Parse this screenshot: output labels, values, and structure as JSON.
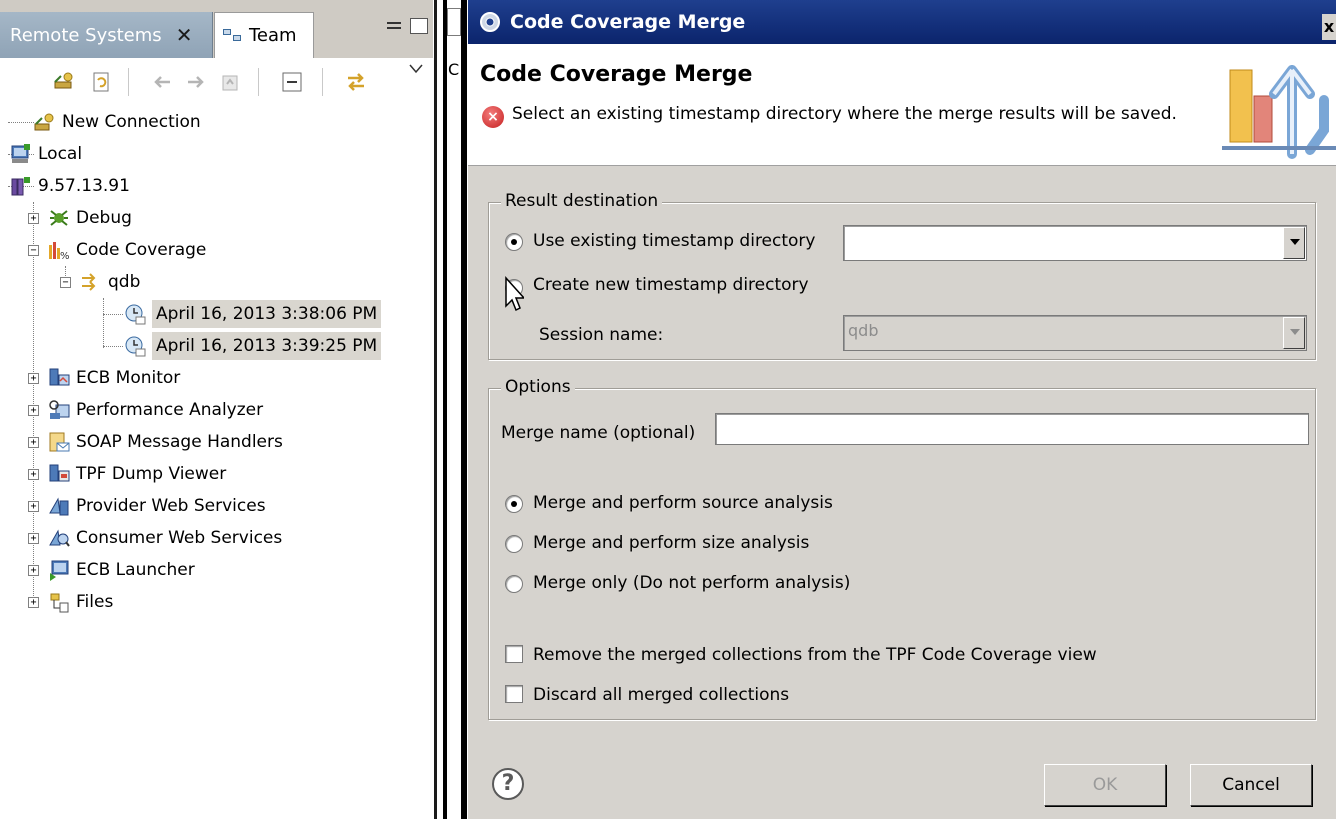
{
  "left_view": {
    "tabs": [
      {
        "label": "Remote Systems",
        "active": true
      },
      {
        "label": "Team",
        "active": false
      }
    ],
    "tree": {
      "items": [
        {
          "label": "New Connection"
        },
        {
          "label": "Local"
        },
        {
          "label": "9.57.13.91"
        },
        {
          "label": "Debug"
        },
        {
          "label": "Code Coverage"
        },
        {
          "label": "qdb"
        },
        {
          "label": "April 16, 2013 3:38:06 PM",
          "selected": true
        },
        {
          "label": "April 16, 2013 3:39:25 PM",
          "selected": true
        },
        {
          "label": "ECB Monitor"
        },
        {
          "label": "Performance Analyzer"
        },
        {
          "label": "SOAP Message Handlers"
        },
        {
          "label": "TPF Dump Viewer"
        },
        {
          "label": "Provider Web Services"
        },
        {
          "label": "Consumer Web Services"
        },
        {
          "label": "ECB Launcher"
        },
        {
          "label": "Files"
        }
      ]
    }
  },
  "editor_strip": {
    "partial_label": "C"
  },
  "dialog": {
    "window_title": "Code Coverage Merge",
    "close_glyph": "x",
    "header": {
      "title": "Code Coverage Merge",
      "error_message": "Select an existing timestamp directory where the merge results will be saved."
    },
    "result_destination": {
      "legend": "Result destination",
      "use_existing_label": "Use existing timestamp directory",
      "use_existing_selected": true,
      "timestamp_value": "",
      "create_new_label": "Create new timestamp directory",
      "create_new_selected": false,
      "session_name_label": "Session name:",
      "session_name_value": "qdb"
    },
    "options": {
      "legend": "Options",
      "merge_name_label": "Merge name (optional)",
      "merge_name_value": "",
      "radios": [
        {
          "label": "Merge and perform source analysis",
          "selected": true
        },
        {
          "label": "Merge and perform size analysis",
          "selected": false
        },
        {
          "label": "Merge only (Do not perform analysis)",
          "selected": false
        }
      ],
      "checkboxes": [
        {
          "label": "Remove the merged collections from the TPF Code Coverage view",
          "checked": false
        },
        {
          "label": "Discard all merged collections",
          "checked": false
        }
      ]
    },
    "buttons": {
      "ok": "OK",
      "cancel": "Cancel",
      "ok_enabled": false
    },
    "help_glyph": "?"
  },
  "colors": {
    "dialog_bg": "#d6d3ce",
    "titlebar": "#0b246c",
    "tab_active": "#8fa3b6",
    "selection": "#d9d6cf",
    "error": "#c51f1f"
  },
  "icons": [
    "new-connection-icon",
    "local-icon",
    "host-icon",
    "debug-icon",
    "code-coverage-icon",
    "qdb-icon",
    "timestamp-icon",
    "ecb-monitor-icon",
    "performance-analyzer-icon",
    "soap-handler-icon",
    "dump-viewer-icon",
    "provider-ws-icon",
    "consumer-ws-icon",
    "ecb-launcher-icon",
    "files-icon",
    "error-icon",
    "help-icon",
    "gear-icon"
  ]
}
